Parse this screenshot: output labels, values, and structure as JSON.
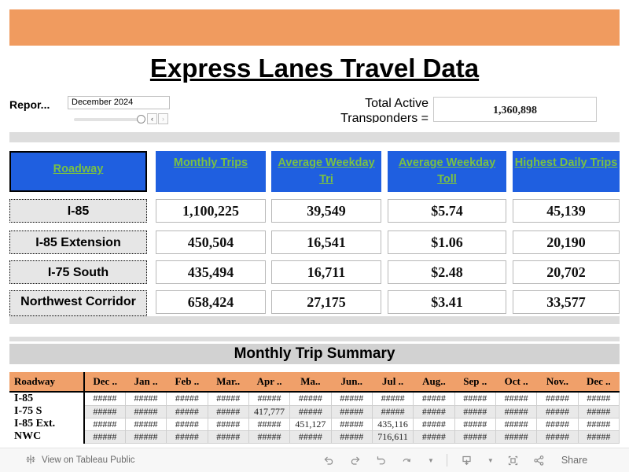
{
  "banner": {
    "color": "#F09B5F"
  },
  "title": "Express Lanes Travel Data",
  "parameter": {
    "label": "Repor...",
    "value": "December 2024",
    "prev_glyph": "‹",
    "next_glyph": "›"
  },
  "transponders": {
    "label": "Total Active Transponders =",
    "value": "1,360,898"
  },
  "kpi": {
    "headers": [
      "Roadway",
      "Monthly Trips",
      "Average Weekday Tri",
      "Average Weekday Toll",
      "Highest Daily Trips"
    ],
    "header_color_bg": "#1F5FE0",
    "header_color_text": "#7AC143",
    "rows": [
      {
        "roadway": "I-85",
        "monthly_trips": "1,100,225",
        "avg_weekday_trips": "39,549",
        "avg_weekday_toll": "$5.74",
        "highest_daily_trips": "45,139"
      },
      {
        "roadway": "I-85 Extension",
        "monthly_trips": "450,504",
        "avg_weekday_trips": "16,541",
        "avg_weekday_toll": "$1.06",
        "highest_daily_trips": "20,190"
      },
      {
        "roadway": "I-75 South",
        "monthly_trips": "435,494",
        "avg_weekday_trips": "16,711",
        "avg_weekday_toll": "$2.48",
        "highest_daily_trips": "20,702"
      },
      {
        "roadway": "Northwest Corridor",
        "monthly_trips": "658,424",
        "avg_weekday_trips": "27,175",
        "avg_weekday_toll": "$3.41",
        "highest_daily_trips": "33,577"
      }
    ]
  },
  "summary": {
    "title": "Monthly Trip Summary",
    "row_header": "Roadway",
    "columns": [
      "Dec ..",
      "Jan ..",
      "Feb ..",
      "Mar..",
      "Apr ..",
      "Ma..",
      "Jun..",
      "Jul ..",
      "Aug..",
      "Sep ..",
      "Oct ..",
      "Nov..",
      "Dec .."
    ],
    "rows": [
      {
        "label": "I-85",
        "values": [
          "#####",
          "#####",
          "#####",
          "#####",
          "#####",
          "#####",
          "#####",
          "#####",
          "#####",
          "#####",
          "#####",
          "#####",
          "#####"
        ]
      },
      {
        "label": "I-75 S",
        "values": [
          "#####",
          "#####",
          "#####",
          "#####",
          "417,777",
          "#####",
          "#####",
          "#####",
          "#####",
          "#####",
          "#####",
          "#####",
          "#####"
        ]
      },
      {
        "label": "I-85 Ext.",
        "values": [
          "#####",
          "#####",
          "#####",
          "#####",
          "#####",
          "451,127",
          "#####",
          "435,116",
          "#####",
          "#####",
          "#####",
          "#####",
          "#####"
        ]
      },
      {
        "label": "NWC",
        "values": [
          "#####",
          "#####",
          "#####",
          "#####",
          "#####",
          "#####",
          "#####",
          "716,611",
          "#####",
          "#####",
          "#####",
          "#####",
          "#####"
        ]
      }
    ]
  },
  "toolbar": {
    "tableau_link": "View on Tableau Public",
    "share_label": "Share",
    "icons": [
      "undo-icon",
      "redo-icon",
      "revert-icon",
      "refresh-icon",
      "pause-icon",
      "download-icon",
      "fullscreen-icon",
      "share-icon"
    ]
  }
}
